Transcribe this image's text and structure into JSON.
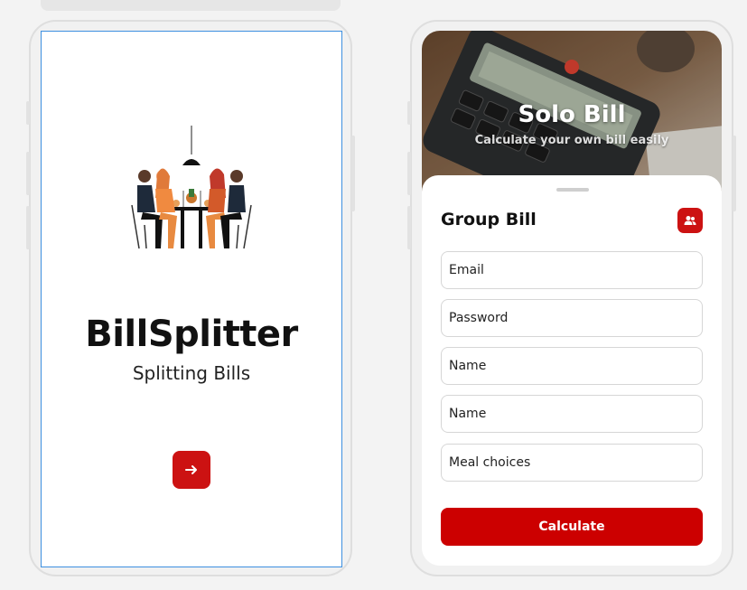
{
  "splash": {
    "title": "BillSplitter",
    "subtitle": "Splitting Bills",
    "next_icon": "arrow-right-icon"
  },
  "solo": {
    "hero_title": "Solo Bill",
    "hero_subtitle": "Calculate your own bill easily"
  },
  "group": {
    "title": "Group Bill",
    "group_icon": "users-icon",
    "fields": {
      "email": "Email",
      "password": "Password",
      "name1": "Name",
      "name2": "Name",
      "meal": "Meal choices"
    },
    "calculate_label": "Calculate"
  },
  "colors": {
    "accent": "#cc1212",
    "screen_bg": "#ffffff",
    "canvas_bg": "#f3f3f3",
    "selection_border": "#3d8fe0"
  }
}
